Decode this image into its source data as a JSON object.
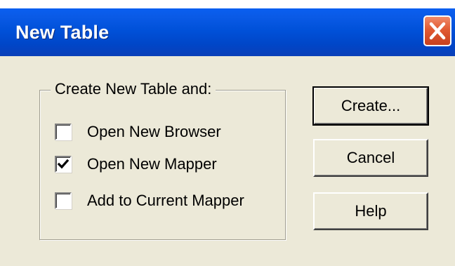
{
  "window": {
    "title": "New Table",
    "close_icon": "close-icon",
    "accent_color": "#0a5ae6",
    "close_color": "#e15a32"
  },
  "group": {
    "legend": "Create New Table and:",
    "options": [
      {
        "label": "Open New Browser",
        "checked": false
      },
      {
        "label": "Open New Mapper",
        "checked": true
      },
      {
        "label": "Add to Current Mapper",
        "checked": false
      }
    ]
  },
  "buttons": {
    "create": "Create...",
    "cancel": "Cancel",
    "help": "Help"
  }
}
